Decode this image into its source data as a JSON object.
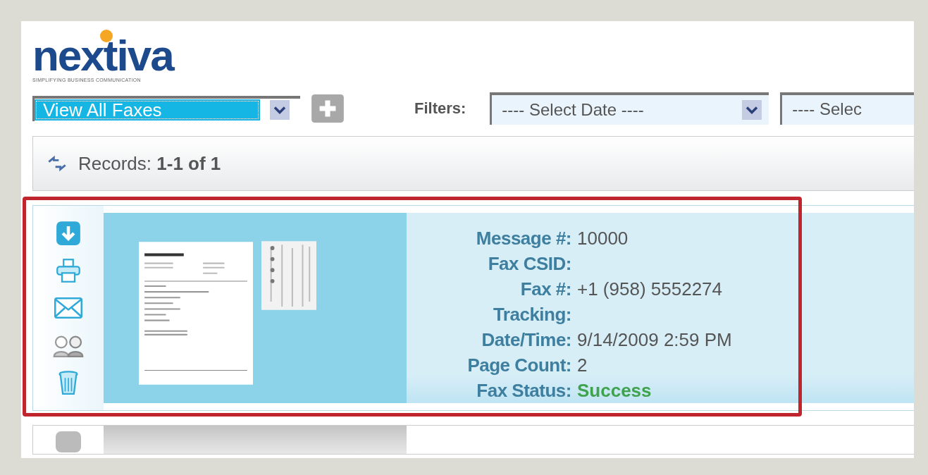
{
  "logo": {
    "name": "nextiva",
    "tagline": "SIMPLIFYING BUSINESS COMMUNICATION"
  },
  "view_select": {
    "value": "View All Faxes"
  },
  "filters": {
    "label": "Filters:",
    "date_select": {
      "value": "---- Select Date ----"
    },
    "second_select": {
      "value": "---- Selec"
    }
  },
  "records": {
    "text": "Records: **1-1 of 1**"
  },
  "fax": {
    "highlighted": true,
    "fields": [
      {
        "label": "Message #:",
        "value": "10000",
        "kind": "plain"
      },
      {
        "label": "Fax CSID:",
        "kind": "plain"
      },
      {
        "label": "Fax #:",
        "value": "+1 (958) 5552274",
        "kind": "plain"
      },
      {
        "label": "Tracking:",
        "kind": "plain"
      },
      {
        "label": "Date/Time:",
        "value": "9/14/2009 2:59 PM",
        "kind": "plain"
      },
      {
        "label": "Page Count:",
        "value": "2",
        "kind": "plain"
      },
      {
        "label": "Fax Status:",
        "value": "Success",
        "kind": "status"
      }
    ]
  }
}
